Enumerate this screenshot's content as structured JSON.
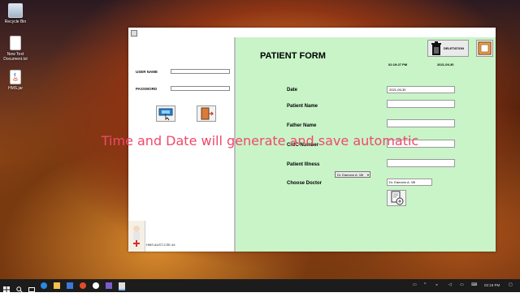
{
  "desktop": {
    "icons": [
      {
        "label": "Recycle Bin"
      },
      {
        "label": "New Text Document.txt"
      },
      {
        "label": "HMS.jar"
      }
    ]
  },
  "login": {
    "username_label": "USER NAME",
    "password_label": "PASSWORD",
    "username_value": "",
    "password_value": "",
    "footer": "HMS  AUST-CSE-44"
  },
  "form": {
    "title": "PATIENT FORM",
    "time": "02:19:27 PM",
    "date": "2021-09-30",
    "deletion_label": "DELETATION",
    "fields": {
      "date_label": "Date",
      "date_value": "2021-09-30",
      "patient_name_label": "Patient Name",
      "patient_name_value": "",
      "father_name_label": "Father Name",
      "father_name_value": "",
      "cnic_label": "CNIC Number",
      "cnic_value": "",
      "illness_label": "Patient Illness",
      "illness_value": "",
      "doctor_label": "Choose Doctor",
      "doctor_select": "Dr. Eamonn A. Vill",
      "doctor_value": "Dr. Eamonn A. Vill"
    }
  },
  "overlay_caption": "Time and Date will generate and save automatic",
  "taskbar": {
    "clock": "02:19 PM"
  },
  "colors": {
    "form_bg": "#c8f4c8",
    "overlay_text": "#f0496a"
  }
}
